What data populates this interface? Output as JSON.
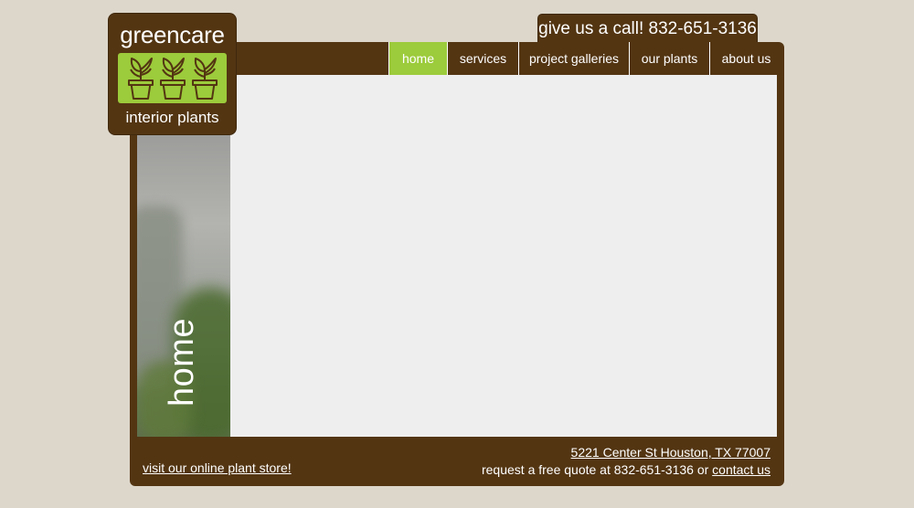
{
  "logo": {
    "top_text": "greencare",
    "bottom_text": "interior plants",
    "plant_icon": "potted-plant-icon",
    "colors": {
      "brown": "#533512",
      "green": "#9ccb3b"
    }
  },
  "call_banner": "give us a call!  832-651-3136",
  "nav": {
    "items": [
      {
        "label": "home",
        "active": true
      },
      {
        "label": "services",
        "active": false
      },
      {
        "label": "project galleries",
        "active": false
      },
      {
        "label": "our plants",
        "active": false
      },
      {
        "label": "about us",
        "active": false
      }
    ]
  },
  "page": {
    "vertical_title": "home"
  },
  "footer": {
    "store_link": "visit our online plant store!",
    "address_link": "5221 Center St Houston, TX 77007",
    "quote_text": "request a free quote at 832-651-3136 or",
    "contact_link": "contact us"
  },
  "colors": {
    "background": "#ddd7cb",
    "frame": "#533512",
    "content": "#eeeeee",
    "accent": "#9ccb3b"
  }
}
